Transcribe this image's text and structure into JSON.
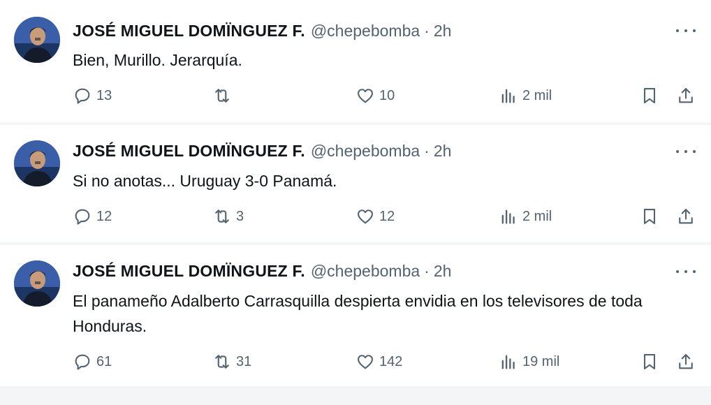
{
  "tweets": [
    {
      "author": {
        "name": "JOSÉ MIGUEL DOMÏNGUEZ F.",
        "handle": "@chepebomba"
      },
      "separator": "·",
      "time": "2h",
      "text": "Bien, Murillo. Jerarquía.",
      "stats": {
        "replies": "13",
        "retweets": "",
        "likes": "10",
        "views": "2 mil"
      }
    },
    {
      "author": {
        "name": "JOSÉ MIGUEL DOMÏNGUEZ F.",
        "handle": "@chepebomba"
      },
      "separator": "·",
      "time": "2h",
      "text": "Si no anotas... Uruguay 3-0 Panamá.",
      "stats": {
        "replies": "12",
        "retweets": "3",
        "likes": "12",
        "views": "2 mil"
      }
    },
    {
      "author": {
        "name": "JOSÉ MIGUEL DOMÏNGUEZ F.",
        "handle": "@chepebomba"
      },
      "separator": "·",
      "time": "2h",
      "text": "El panameño Adalberto Carrasquilla despierta envidia en los televisores de toda Honduras.",
      "stats": {
        "replies": "61",
        "retweets": "31",
        "likes": "142",
        "views": "19 mil"
      }
    }
  ],
  "icons": {
    "reply": "speech-bubble-icon",
    "retweet": "retweet-arrows-icon",
    "like": "heart-icon",
    "views": "bar-chart-icon",
    "bookmark": "bookmark-icon",
    "share": "share-upload-icon",
    "more": "more-horizontal-icon"
  },
  "colors": {
    "text": "#0f1419",
    "secondary": "#536471",
    "background": "#ffffff",
    "divider": "#eef1f4"
  }
}
